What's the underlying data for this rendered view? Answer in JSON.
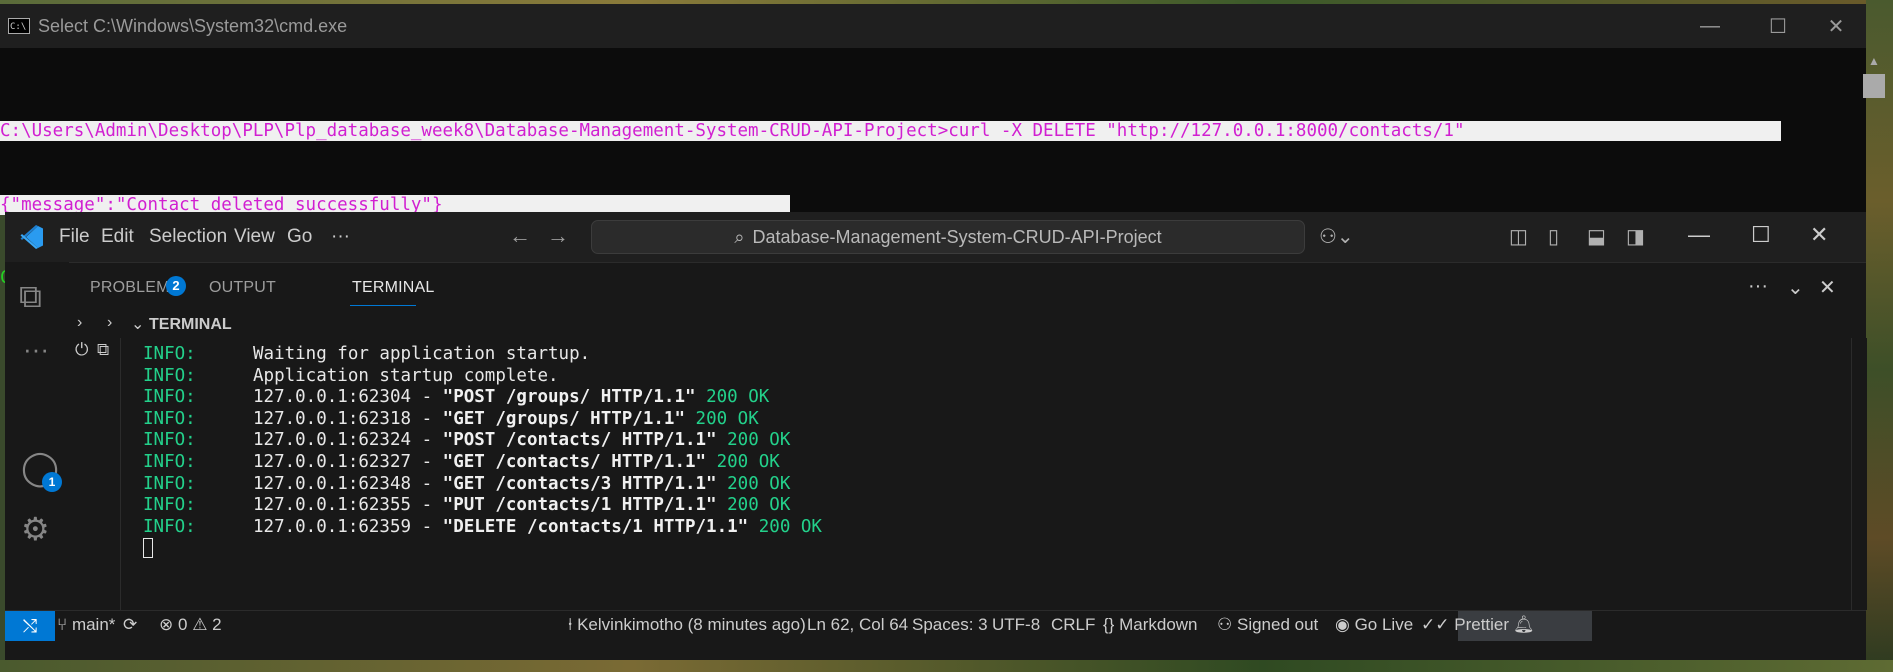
{
  "cmd": {
    "title": "Select C:\\Windows\\System32\\cmd.exe",
    "icon_text": "C:\\",
    "prompt": "C:\\Users\\Admin\\Desktop\\PLP\\Plp_database_week8\\Database-Management-System-CRUD-API-Project>",
    "command": "curl -X DELETE \"http://127.0.0.1:8000/contacts/1\"",
    "response": "{\"message\":\"Contact deleted successfully\"}",
    "controls": {
      "minimize": "—",
      "maximize": "☐",
      "close": "✕"
    }
  },
  "vscode": {
    "menu": [
      "File",
      "Edit",
      "Selection",
      "View",
      "Go",
      "···"
    ],
    "search_title": "Database-Management-System-CRUD-API-Project",
    "panel_tabs": {
      "problems": "PROBLEMS",
      "problems_count": "2",
      "output": "OUTPUT",
      "terminal": "TERMINAL"
    },
    "terminal_section_title": "TERMINAL",
    "account_badge": "1",
    "terminal_lines": [
      {
        "level": "INFO:",
        "text": "Waiting for application startup."
      },
      {
        "level": "INFO:",
        "text": "Application startup complete."
      },
      {
        "level": "INFO:",
        "client": "127.0.0.1:62304 - ",
        "request": "\"POST /groups/ HTTP/1.1\"",
        "status": "200 OK"
      },
      {
        "level": "INFO:",
        "client": "127.0.0.1:62318 - ",
        "request": "\"GET /groups/ HTTP/1.1\"",
        "status": "200 OK"
      },
      {
        "level": "INFO:",
        "client": "127.0.0.1:62324 - ",
        "request": "\"POST /contacts/ HTTP/1.1\"",
        "status": "200 OK"
      },
      {
        "level": "INFO:",
        "client": "127.0.0.1:62327 - ",
        "request": "\"GET /contacts/ HTTP/1.1\"",
        "status": "200 OK"
      },
      {
        "level": "INFO:",
        "client": "127.0.0.1:62348 - ",
        "request": "\"GET /contacts/3 HTTP/1.1\"",
        "status": "200 OK"
      },
      {
        "level": "INFO:",
        "client": "127.0.0.1:62355 - ",
        "request": "\"PUT /contacts/1 HTTP/1.1\"",
        "status": "200 OK"
      },
      {
        "level": "INFO:",
        "client": "127.0.0.1:62359 - ",
        "request": "\"DELETE /contacts/1 HTTP/1.1\"",
        "status": "200 OK"
      }
    ],
    "status_bar": {
      "branch": "main*",
      "errors": "0",
      "warnings": "2",
      "blame": "Kelvinkimotho (8 minutes ago)",
      "position": "Ln 62, Col 64",
      "spaces": "Spaces: 3",
      "encoding": "UTF-8",
      "eol": "CRLF",
      "language": "Markdown",
      "signed_out": "Signed out",
      "go_live": "Go Live",
      "prettier": "Prettier"
    },
    "colors": {
      "accent": "#0078d4",
      "terminal_green": "#23d18b",
      "cmd_green": "#23d123",
      "cmd_magenta": "#d11fd1"
    }
  }
}
